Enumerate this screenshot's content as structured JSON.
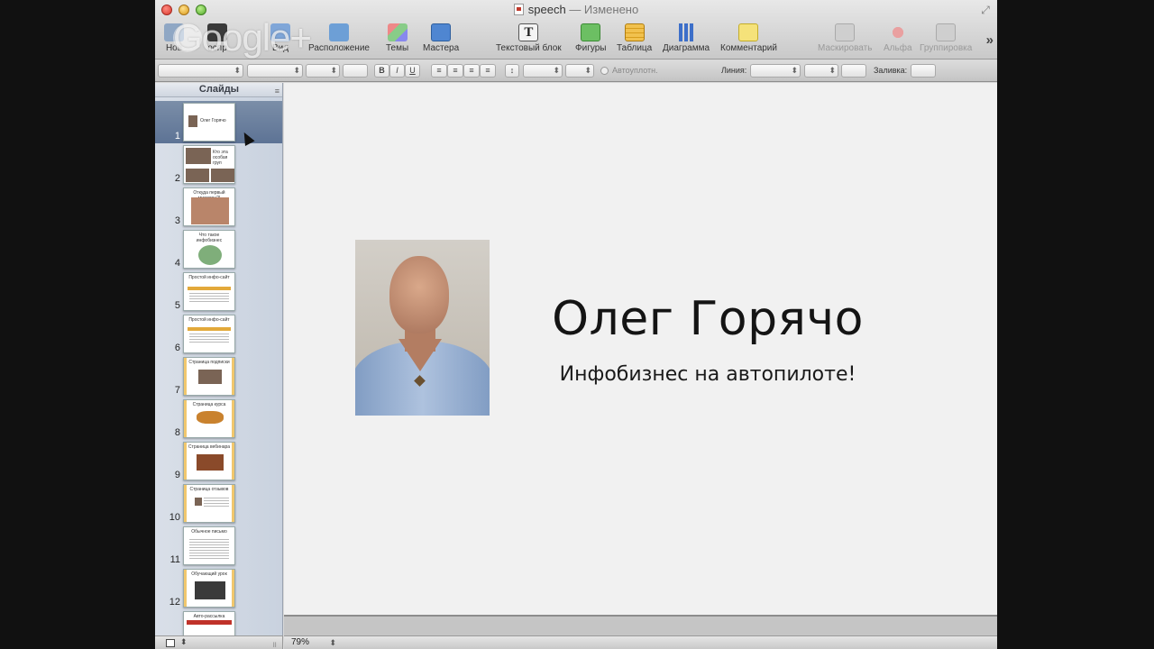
{
  "window": {
    "title": "speech",
    "status": "— Изменено"
  },
  "toolbar": {
    "left": [
      {
        "label": "Нов",
        "icon": "new-slide-icon"
      },
      {
        "label": "оспр",
        "icon": "play-icon"
      },
      {
        "label": "Вид",
        "icon": "view-icon"
      },
      {
        "label": "Расположение",
        "icon": "layout-icon"
      },
      {
        "label": "Темы",
        "icon": "themes-icon"
      },
      {
        "label": "Мастера",
        "icon": "masters-icon"
      }
    ],
    "center": [
      {
        "label": "Текстовый блок",
        "icon": "text-box-icon"
      },
      {
        "label": "Фигуры",
        "icon": "shapes-icon"
      },
      {
        "label": "Таблица",
        "icon": "table-icon"
      },
      {
        "label": "Диаграмма",
        "icon": "chart-icon"
      },
      {
        "label": "Комментарий",
        "icon": "comment-icon"
      }
    ],
    "right": [
      {
        "label": "Маскировать",
        "icon": "mask-icon"
      },
      {
        "label": "Альфа",
        "icon": "alpha-icon"
      },
      {
        "label": "Группировка",
        "icon": "group-icon"
      }
    ],
    "more_glyph": "»"
  },
  "watermark": {
    "text": "Google+"
  },
  "formatbar": {
    "bold": "B",
    "italic": "I",
    "underline": "U",
    "autofit": "Автоуплотн.",
    "line_label": "Линия:",
    "fill_label": "Заливка:"
  },
  "navigator": {
    "header": "Слайды",
    "slides": [
      {
        "num": "1",
        "title": "Олег Горячо"
      },
      {
        "num": "2",
        "title": "Кто эта особая груп"
      },
      {
        "num": "3",
        "title": "Откуда первый миллион?!"
      },
      {
        "num": "4",
        "title": "Что такое инфобизнес"
      },
      {
        "num": "5",
        "title": "Простой инфо-сайт"
      },
      {
        "num": "6",
        "title": "Простой инфо-сайт"
      },
      {
        "num": "7",
        "title": "Страница подписки"
      },
      {
        "num": "8",
        "title": "Страница курса"
      },
      {
        "num": "9",
        "title": "Страница вебинара"
      },
      {
        "num": "10",
        "title": "Страница отзывов"
      },
      {
        "num": "11",
        "title": "Обычное письмо"
      },
      {
        "num": "12",
        "title": "Обучающий урок"
      },
      {
        "num": "13",
        "title": "Авто-рассылка"
      }
    ]
  },
  "slide": {
    "title": "Олег Горячо",
    "subtitle": "Инфобизнес на автопилоте!"
  },
  "status": {
    "zoom": "79%"
  },
  "colors": {
    "selection": "#5d7395",
    "slide_background": "#f1f1f1",
    "title_text": "#141414"
  }
}
